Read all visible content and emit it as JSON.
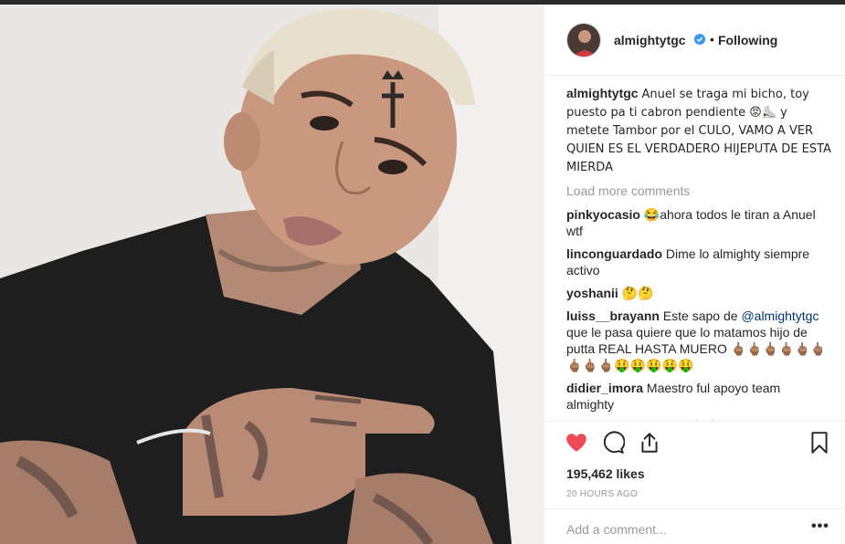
{
  "post": {
    "username": "almightytgc",
    "follow_state": "Following",
    "dot": "•",
    "caption": "Anuel se traga mi bicho, toy puesto pa ti cabron pendiente 😡⛸️ y metete Tambor por el CULO, VAMO A VER QUIEN ES EL VERDADERO HIJEPUTA DE ESTA MIERDA",
    "load_more": "Load more comments",
    "comments": [
      {
        "user": "pinkyocasio",
        "text": "😂ahora todos le tiran a Anuel wtf"
      },
      {
        "user": "linconguardado",
        "text": "Dime lo almighty siempre activo"
      },
      {
        "user": "yoshanii",
        "text": "🤔🤔"
      },
      {
        "user": "luiss__brayann",
        "text_before": "Este sapo de ",
        "mention": "@almightytgc",
        "text_after": " que le pasa quiere que lo matamos hijo de putta REAL HASTA MUERO 🖕🏽🖕🏽🖕🏽🖕🏽🖕🏽🖕🏽🖕🏽🖕🏽🖕🏽🤑🤑🤑🤑🤑"
      },
      {
        "user": "didier_imora",
        "text": "Maestro ful apoyo team almighty"
      },
      {
        "user": "macdanielbreezy",
        "text": "👁️⚙️🔥"
      }
    ],
    "likes": "195,462 likes",
    "time_ago": "20 HOURS AGO",
    "add_comment_placeholder": "Add a comment...",
    "more_options": "•••"
  },
  "icons": {
    "like": "heart-icon",
    "comment": "comment-icon",
    "share": "share-icon",
    "save": "bookmark-icon",
    "verified": "verified-badge-icon"
  },
  "colors": {
    "like_red": "#ed4956",
    "verified_blue": "#3897f0",
    "mention_blue": "#003569",
    "muted_gray": "#999999"
  }
}
